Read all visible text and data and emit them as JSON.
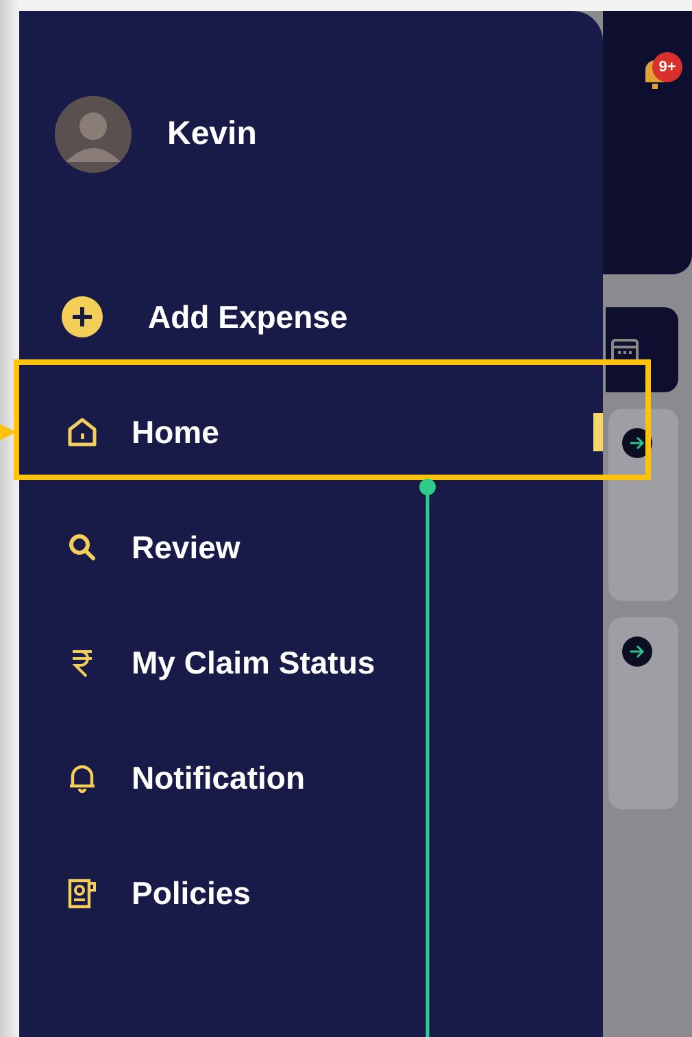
{
  "drawer": {
    "user": {
      "name": "Kevin"
    },
    "items": [
      {
        "label": "Add Expense",
        "selected": false
      },
      {
        "label": "Home",
        "selected": true
      },
      {
        "label": "Review",
        "selected": false
      },
      {
        "label": "My Claim Status",
        "selected": false
      },
      {
        "label": "Notification",
        "selected": false
      },
      {
        "label": "Policies",
        "selected": false
      }
    ]
  },
  "header": {
    "notification_badge": "9+"
  }
}
